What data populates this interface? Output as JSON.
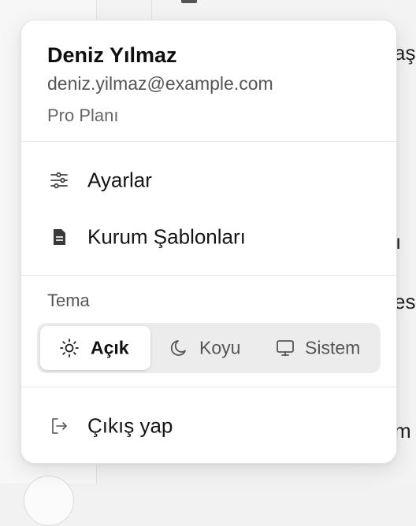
{
  "user": {
    "name": "Deniz Yılmaz",
    "email": "deniz.yilmaz@example.com",
    "plan": "Pro Planı"
  },
  "menu_items": [
    {
      "label": "Ayarlar",
      "icon": "sliders-icon"
    },
    {
      "label": "Kurum Şablonları",
      "icon": "document-icon"
    }
  ],
  "theme": {
    "heading": "Tema",
    "options": [
      {
        "label": "Açık",
        "icon": "sun-icon",
        "selected": true
      },
      {
        "label": "Koyu",
        "icon": "moon-icon",
        "selected": false
      },
      {
        "label": "Sistem",
        "icon": "monitor-icon",
        "selected": false
      }
    ]
  },
  "logout": {
    "label": "Çıkış yap",
    "icon": "logout-icon"
  },
  "background": {
    "snippets": [
      "aş",
      "ı",
      "es",
      "m"
    ]
  },
  "colors": {
    "menu_bg": "#ffffff",
    "switch_bg": "#ececec",
    "text_primary": "#111111",
    "text_secondary": "#555555",
    "divider": "#e4e4e4"
  }
}
